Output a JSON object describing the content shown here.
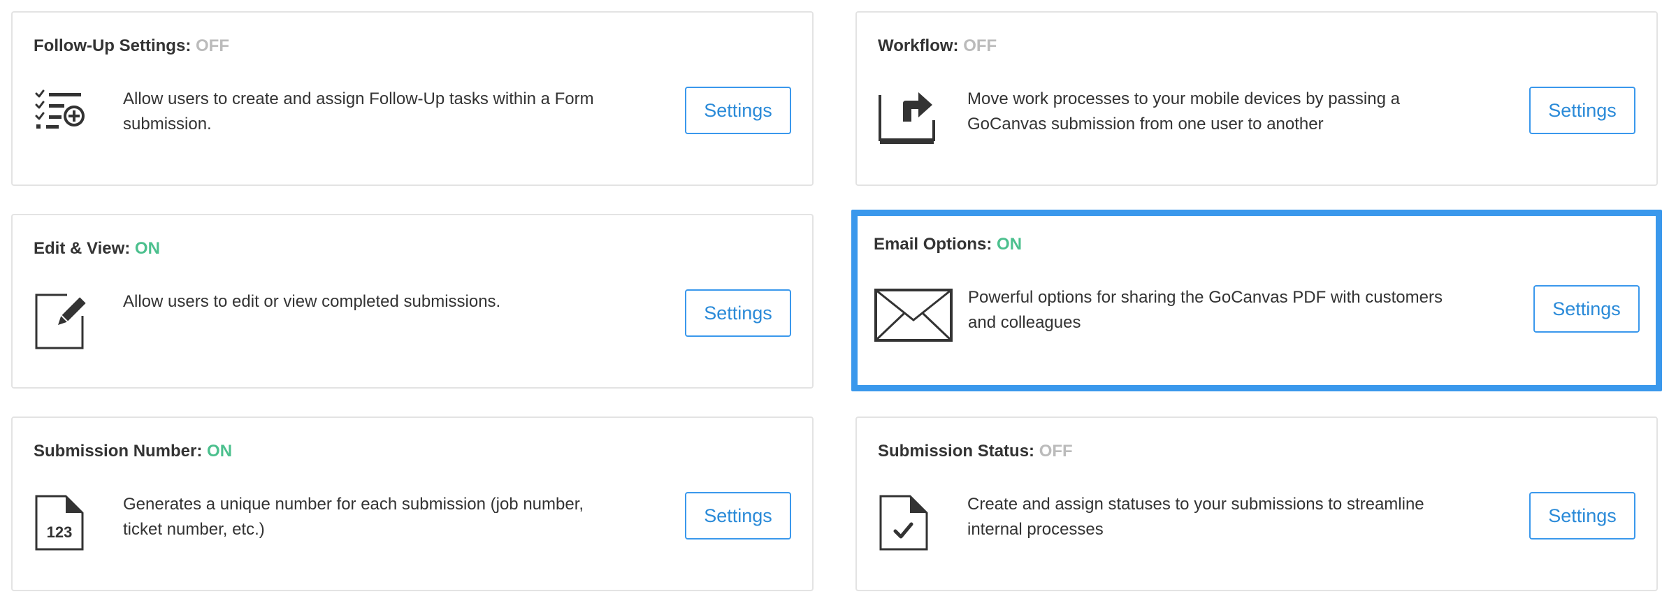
{
  "colors": {
    "on": "#4cc08e",
    "off": "#bbbbbb",
    "accent": "#3a98ec",
    "card_border": "#e3e3e3"
  },
  "cards": [
    {
      "title": "Follow-Up Settings:",
      "status": "OFF",
      "icon": "follow-up-tasks-icon",
      "description": "Allow users to create and assign Follow-Up tasks within a Form submission.",
      "button": "Settings"
    },
    {
      "title": "Workflow:",
      "status": "OFF",
      "icon": "workflow-share-icon",
      "description": "Move work processes to your mobile devices by passing a GoCanvas submission from one user to another",
      "button": "Settings"
    },
    {
      "title": "Edit & View:",
      "status": "ON",
      "icon": "edit-pencil-icon",
      "description": "Allow users to edit or view completed submissions.",
      "button": "Settings"
    },
    {
      "title": "Email Options:",
      "status": "ON",
      "icon": "envelope-icon",
      "description": "Powerful options for sharing the GoCanvas PDF with customers and colleagues",
      "button": "Settings",
      "selected": true
    },
    {
      "title": "Submission Number:",
      "status": "ON",
      "icon": "number-document-icon",
      "icon_text": "123",
      "description": "Generates a unique number for each submission (job number, ticket number, etc.)",
      "button": "Settings"
    },
    {
      "title": "Submission Status:",
      "status": "OFF",
      "icon": "status-checkmark-document-icon",
      "description": "Create and assign statuses to your submissions to streamline internal processes",
      "button": "Settings"
    }
  ]
}
